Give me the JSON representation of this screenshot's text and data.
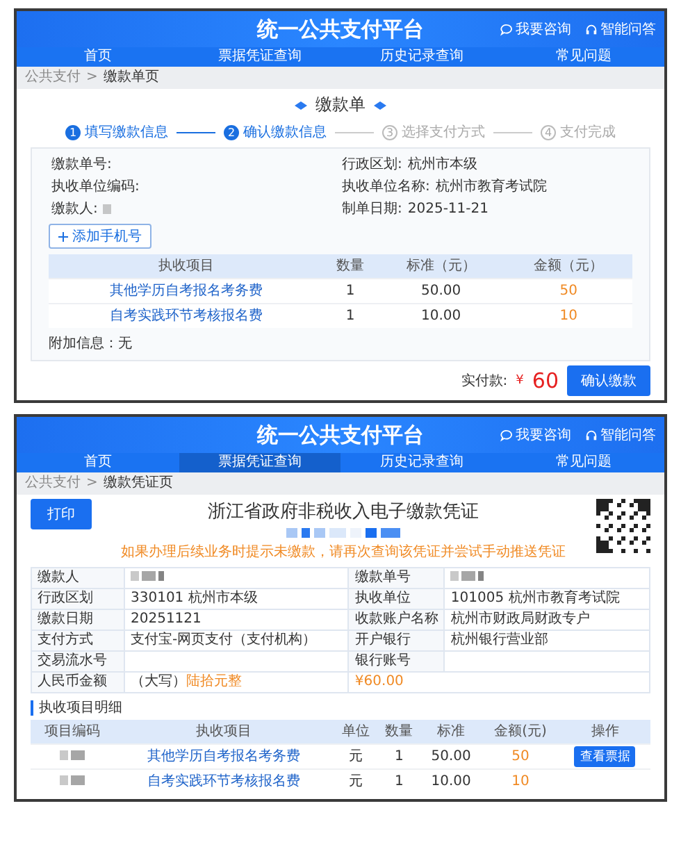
{
  "payment_form": {
    "header": {
      "title": "统一公共支付平台",
      "links": [
        {
          "label": "我要咨询",
          "kind": "chat"
        },
        {
          "label": "智能问答",
          "kind": "headset"
        }
      ]
    },
    "nav": [
      {
        "label": "首页",
        "selected": false
      },
      {
        "label": "票据凭证查询",
        "selected": false
      },
      {
        "label": "历史记录查询",
        "selected": false
      },
      {
        "label": "常见问题",
        "selected": false
      }
    ],
    "breadcrumb": {
      "parent": "公共支付",
      "separator": ">",
      "current": "缴款单页"
    },
    "title": "缴款单",
    "steps": [
      {
        "number": "1",
        "label": "填写缴款信息",
        "done": true
      },
      {
        "number": "2",
        "label": "确认缴款信息",
        "done": true
      },
      {
        "number": "3",
        "label": "选择支付方式",
        "done": false
      },
      {
        "number": "4",
        "label": "支付完成",
        "done": false
      }
    ],
    "fields": [
      {
        "label": "缴款单号:"
      },
      {
        "label": "行政区划:",
        "value": "杭州市本级"
      },
      {
        "label": "执收单位编码:"
      },
      {
        "label": "执收单位名称:",
        "value": "杭州市教育考试院"
      },
      {
        "label": "缴款人:",
        "masked": true
      },
      {
        "label": "制单日期:",
        "value": "2025-11-21"
      }
    ],
    "add_phone_button": "添加手机号",
    "table": {
      "columns": [
        "执收项目",
        "数量",
        "标准（元）",
        "金额（元）"
      ],
      "rows": [
        {
          "item": "其他学历自考报名考务费",
          "quantity": "1",
          "standard": "50.00",
          "amount": "50"
        },
        {
          "item": "自考实践环节考核报名费",
          "quantity": "1",
          "standard": "10.00",
          "amount": "10"
        }
      ]
    },
    "extra_info": "附加信息：无",
    "total_label": "实付款:",
    "total_currency": "¥",
    "total_value": "60",
    "confirm_button": "确认缴款"
  },
  "voucher": {
    "header": {
      "title": "统一公共支付平台",
      "links": [
        {
          "label": "我要咨询",
          "kind": "chat"
        },
        {
          "label": "智能问答",
          "kind": "headset"
        }
      ]
    },
    "nav": [
      {
        "label": "首页",
        "selected": false
      },
      {
        "label": "票据凭证查询",
        "selected": true
      },
      {
        "label": "历史记录查询",
        "selected": false
      },
      {
        "label": "常见问题",
        "selected": false
      }
    ],
    "breadcrumb": {
      "parent": "公共支付",
      "separator": ">",
      "current": "缴款凭证页"
    },
    "print_button": "打印",
    "title": "浙江省政府非税收入电子缴款凭证",
    "notice": "如果办理后续业务时提示未缴款，请再次查询该凭证并尝试手动推送凭证",
    "rows": [
      [
        {
          "label": "缴款人",
          "masked": true
        },
        {
          "label": "缴款单号",
          "masked": true
        }
      ],
      [
        {
          "label": "行政区划",
          "value": "330101  杭州市本级"
        },
        {
          "label": "执收单位",
          "value": "101005  杭州市教育考试院"
        }
      ],
      [
        {
          "label": "缴款日期",
          "value": "20251121"
        },
        {
          "label": "收款账户名称",
          "value": "杭州市财政局财政专户"
        }
      ],
      [
        {
          "label": "支付方式",
          "value": "支付宝-网页支付（支付机构）"
        },
        {
          "label": "开户银行",
          "value": "杭州银行营业部"
        }
      ],
      [
        {
          "label": "交易流水号"
        },
        {
          "label": "银行账号"
        }
      ]
    ],
    "amount_row": {
      "label": "人民币金额",
      "uppercase_label": "（大写）",
      "uppercase_amount": "陆拾元整",
      "amount": "¥60.00"
    },
    "section_title": "执收项目明细",
    "detail": {
      "columns": [
        "项目编码",
        "执收项目",
        "单位",
        "数量",
        "标准",
        "金额(元)",
        "操作"
      ],
      "rows": [
        {
          "code_masked": true,
          "item": "其他学历自考报名考务费",
          "unit": "元",
          "quantity": "1",
          "standard": "50.00",
          "amount": "50",
          "action": "查看票据"
        },
        {
          "code_masked": true,
          "item": "自考实践环节考核报名费",
          "unit": "元",
          "quantity": "1",
          "standard": "10.00",
          "amount": "10"
        }
      ]
    }
  }
}
